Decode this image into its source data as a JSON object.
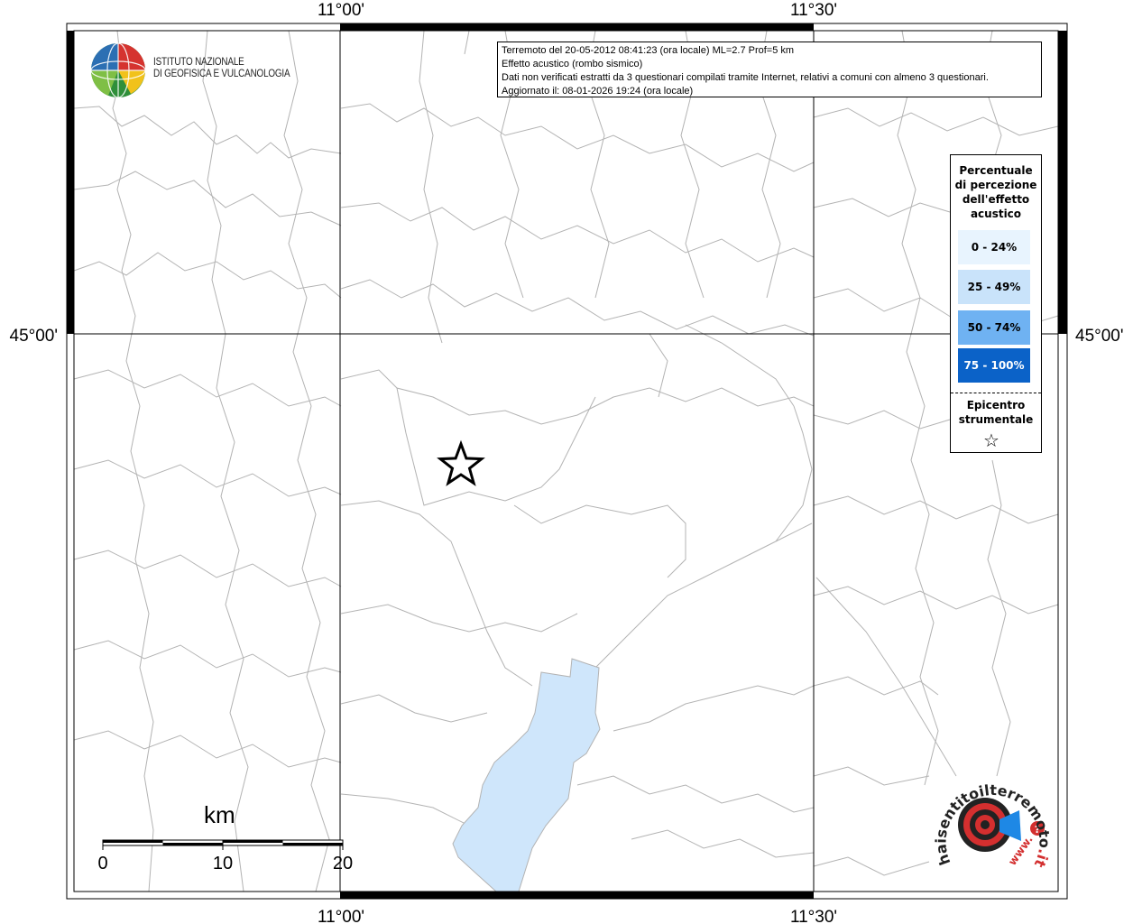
{
  "map": {
    "top_tick_left": "11°00'",
    "top_tick_right": "11°30'",
    "bottom_tick_left": "11°00'",
    "bottom_tick_right": "11°30'",
    "left_lat_label": "45°00'",
    "right_lat_label": "45°00'"
  },
  "info": {
    "line1": "Terremoto del 20-05-2012 08:41:23 (ora locale) ML=2.7 Prof=5 km",
    "line2": "Effetto acustico (rombo sismico)",
    "line3": "Dati non verificati estratti da 3 questionari compilati tramite Internet, relativi a comuni con almeno 3 questionari.",
    "line4": "Aggiornato il: 08-01-2026 19:24 (ora locale)"
  },
  "logo": {
    "line1": "ISTITUTO NAZIONALE",
    "line2": "DI GEOFISICA E VULCANOLOGIA"
  },
  "legend": {
    "title_lines": [
      "Percentuale",
      "di percezione",
      "dell'effetto",
      "acustico"
    ],
    "items": [
      {
        "label": "0 - 24%",
        "color": "#e8f4fe",
        "text_color": "#000000"
      },
      {
        "label": "25 - 49%",
        "color": "#c9e3fa",
        "text_color": "#000000"
      },
      {
        "label": "50 - 74%",
        "color": "#6fb2f2",
        "text_color": "#000000"
      },
      {
        "label": "75 - 100%",
        "color": "#0b62c8",
        "text_color": "#ffffff"
      }
    ],
    "epicenter_lines": [
      "Epicentro",
      "strumentale"
    ],
    "epicenter_symbol": "☆"
  },
  "scale": {
    "unit": "km",
    "labels": [
      "0",
      "10",
      "20"
    ]
  },
  "colors": {
    "boundary": "#b3b3b3",
    "highlight_fill": "#cfe6fb",
    "frame": "#000000"
  },
  "badge": {
    "text_main": "haisentitoilterremoto",
    "text_suffix": ".it",
    "text_www": "www."
  }
}
